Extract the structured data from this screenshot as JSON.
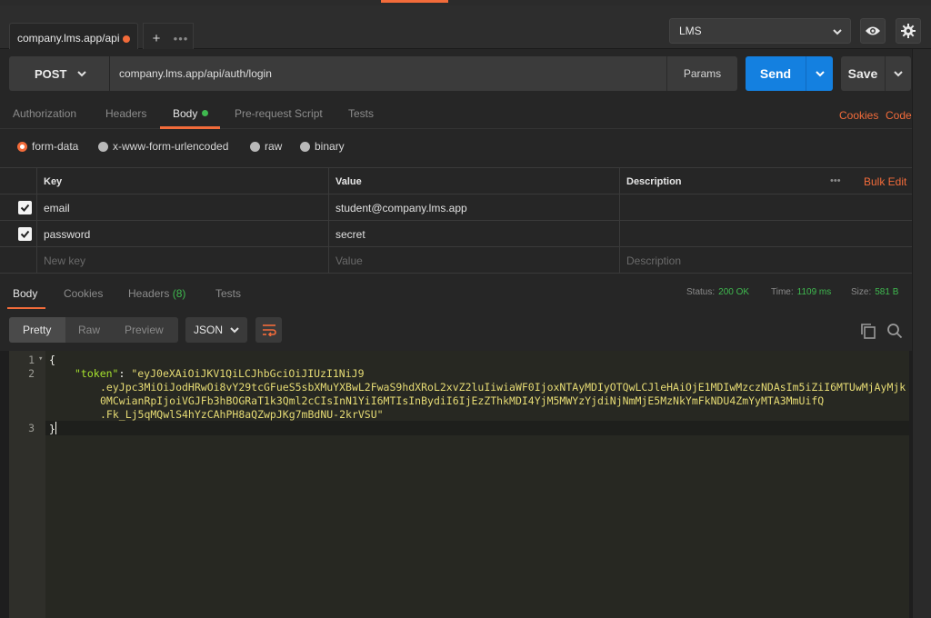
{
  "tabs": {
    "active_label": "company.lms.app/api",
    "add_label": "+",
    "more_label": "•••"
  },
  "environment": {
    "selected": "LMS"
  },
  "icons": {
    "eye": "eye-icon",
    "settings": "gear-icon",
    "wrap": "wrap-icon",
    "copy": "copy-icon",
    "search": "search-icon"
  },
  "request": {
    "method": "POST",
    "url": "company.lms.app/api/auth/login",
    "params_label": "Params",
    "send_label": "Send",
    "save_label": "Save"
  },
  "request_tabs": {
    "authorization": "Authorization",
    "headers": "Headers",
    "body": "Body",
    "prerequest": "Pre-request Script",
    "tests": "Tests",
    "cookies": "Cookies",
    "code": "Code"
  },
  "body_types": {
    "form_data": "form-data",
    "urlencoded": "x-www-form-urlencoded",
    "raw": "raw",
    "binary": "binary",
    "selected": "form-data"
  },
  "params_table": {
    "headers": {
      "key": "Key",
      "value": "Value",
      "description": "Description",
      "more": "•••",
      "bulk_edit": "Bulk Edit"
    },
    "rows": [
      {
        "key": "email",
        "value": "student@company.lms.app",
        "description": "",
        "checked": true
      },
      {
        "key": "password",
        "value": "secret",
        "description": "",
        "checked": true
      }
    ],
    "new_row": {
      "key": "New key",
      "value": "Value",
      "description": "Description"
    }
  },
  "response_tabs": {
    "body": "Body",
    "cookies": "Cookies",
    "headers": "Headers",
    "headers_count": "(8)",
    "tests": "Tests"
  },
  "response_status": {
    "status_label": "Status:",
    "status_value": "200 OK",
    "time_label": "Time:",
    "time_value": "1109 ms",
    "size_label": "Size:",
    "size_value": "581 B"
  },
  "response_view": {
    "pretty": "Pretty",
    "raw": "Raw",
    "preview": "Preview",
    "format": "JSON"
  },
  "response_code": {
    "line_numbers": [
      "1",
      "2",
      "3"
    ],
    "open_brace": "{",
    "key": "\"token\"",
    "colon": ": ",
    "value_lines": [
      "\"eyJ0eXAiOiJKV1QiLCJhbGciOiJIUzI1NiJ9",
      ".eyJpc3MiOiJodHRwOi8vY29tcGFueS5sbXMuYXBwL2FwaS9hdXRoL2xvZ2luIiwiaWF0IjoxNTAyMDIyOTQwLCJleHAiOjE1MDIwMzczNDAsIm5iZiI6MTUwMjAyMjk",
      "0MCwianRpIjoiVGJFb3hBOGRaT1k3Qml2cCIsInN1YiI6MTIsInBydiI6IjEzZThkMDI4YjM5MWYzYjdiNjNmMjE5MzNkYmFkNDU4ZmYyMTA3MmUifQ",
      ".Fk_Lj5qMQwlS4hYzCAhPH8aQZwpJKg7mBdNU-2krVSU\""
    ],
    "close_brace": "}"
  },
  "colors": {
    "accent": "#f26b3a",
    "send_blue": "#1480e0",
    "success_green": "#3fb94f",
    "json_key": "#a6e22e",
    "json_string": "#e6db74"
  }
}
